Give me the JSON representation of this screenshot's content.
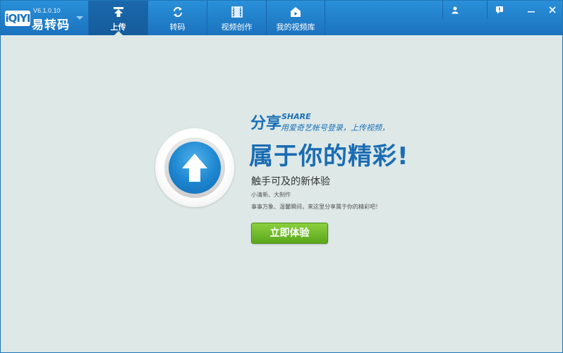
{
  "app": {
    "logo_text": "iQIYI",
    "version": "V6.1.0.10",
    "name": "易转码"
  },
  "tabs": [
    {
      "label": "上传",
      "icon": "upload-icon",
      "active": true
    },
    {
      "label": "转码",
      "icon": "refresh-icon",
      "active": false
    },
    {
      "label": "视频创作",
      "icon": "film-icon",
      "active": false
    },
    {
      "label": "我的视频库",
      "icon": "home-icon",
      "active": false
    }
  ],
  "window_controls": [
    "user-icon",
    "alert-icon",
    "minimize-icon",
    "close-icon"
  ],
  "promo": {
    "share_title": "分享",
    "share_en": "SHARE",
    "share_sub": "用爱奇艺帐号登录，上传视频，",
    "headline": "属于你的精彩!",
    "subtitle": "触手可及的新体验",
    "line1": "小清新、大制作",
    "line2": "事事万象、温馨瞬间，来这里分享属于你的精彩吧！",
    "cta": "立即体验"
  },
  "colors": {
    "topbar": "#1b72be",
    "background": "#dde8e7",
    "accent_blue": "#1a70b8",
    "cta_green": "#6cba28"
  }
}
